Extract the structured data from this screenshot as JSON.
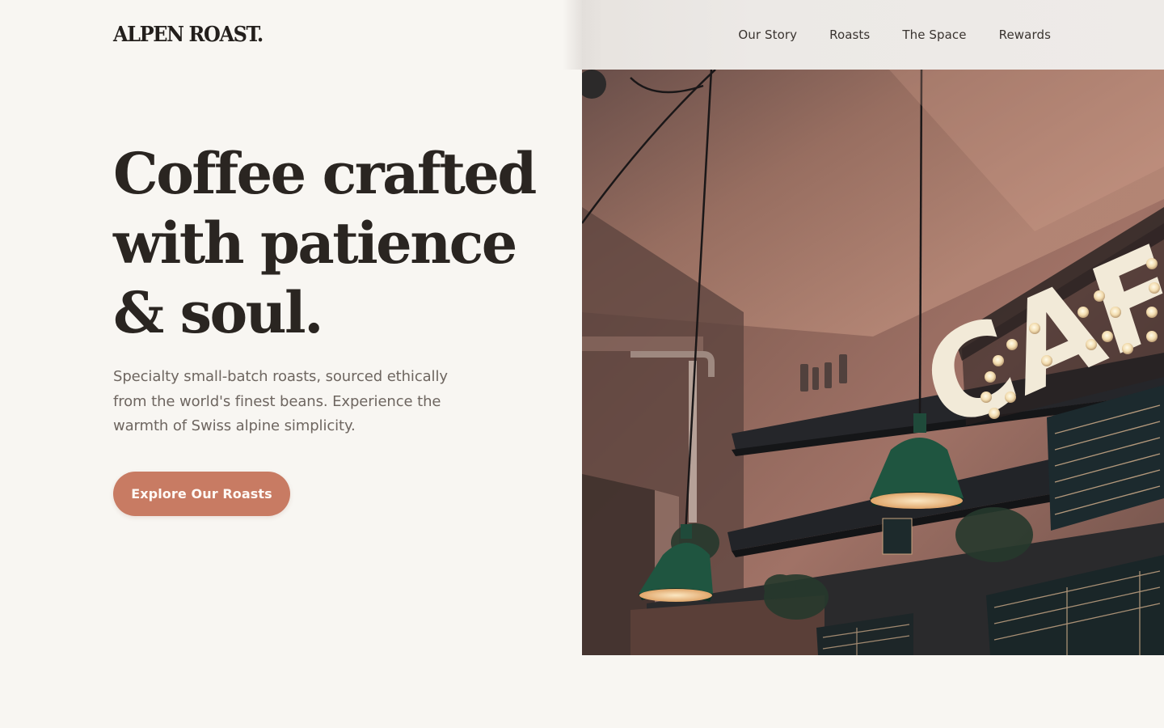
{
  "header": {
    "logo": "ALPEN ROAST.",
    "nav": [
      "Our Story",
      "Roasts",
      "The Space",
      "Rewards"
    ]
  },
  "hero": {
    "title": "Coffee crafted with patience & soul.",
    "subtitle": "Specialty small-batch roasts, sourced ethically from the world's finest beans. Experience the warmth of Swiss alpine simplicity.",
    "cta_label": "Explore Our Roasts",
    "image_sign_text": "CAF"
  },
  "colors": {
    "background": "#f8f6f2",
    "accent": "#c87b63",
    "heading": "#2a2521",
    "body_text": "#6e6660"
  },
  "icons": [
    "cafe-marquee-sign",
    "pendant-lamp"
  ]
}
